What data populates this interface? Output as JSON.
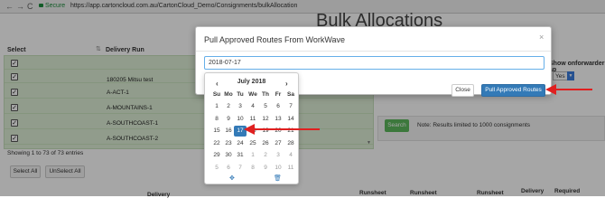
{
  "browser": {
    "back": "←",
    "forward": "→",
    "reload": "C",
    "secure_label": "Secure",
    "url": "https://app.cartoncloud.com.au/CartonCloud_Demo/Consignments/bulkAllocation"
  },
  "page": {
    "title": "Bulk Allocations",
    "select_header": "Select",
    "delivery_run_header": "Delivery Run",
    "rows": [
      {
        "label": ""
      },
      {
        "label": "180205 Mitsu test"
      },
      {
        "label": "A-ACT-1"
      },
      {
        "label": "A-MOUNTAINS-1"
      },
      {
        "label": "A-SOUTHCOAST-1"
      },
      {
        "label": "A-SOUTHCOAST-2"
      }
    ],
    "showing": "Showing 1 to 73 of 73 entries",
    "select_all": "Select All",
    "unselect_all": "UnSelect All",
    "forwarder_label": "Show onforwarder ap",
    "forwarder_value": "Yes",
    "search_button": "Search",
    "note": "Note: Results limited to 1000 consignments",
    "bottom_headers": [
      "Delivery",
      "Runsheet",
      "Runsheet",
      "Runsheet",
      "Delivery",
      "Required"
    ]
  },
  "modal": {
    "title": "Pull Approved Routes From WorkWave",
    "close_x": "×",
    "date_value": "2018-07-17",
    "close_label": "Close",
    "pull_label": "Pull Approved Routes"
  },
  "datepicker": {
    "month_label": "July 2018",
    "prev": "‹",
    "next": "›",
    "dow": [
      "Su",
      "Mo",
      "Tu",
      "We",
      "Th",
      "Fr",
      "Sa"
    ],
    "weeks": [
      [
        "1",
        "2",
        "3",
        "4",
        "5",
        "6",
        "7"
      ],
      [
        "8",
        "9",
        "10",
        "11",
        "12",
        "13",
        "14"
      ],
      [
        "15",
        "16",
        "17",
        "18",
        "19",
        "20",
        "21"
      ],
      [
        "22",
        "23",
        "24",
        "25",
        "26",
        "27",
        "28"
      ],
      [
        "29",
        "30",
        "31",
        "1",
        "2",
        "3",
        "4"
      ],
      [
        "5",
        "6",
        "7",
        "8",
        "9",
        "10",
        "11"
      ]
    ],
    "selected_day": "17",
    "clock_icon": "✥",
    "trash_icon": "🗑"
  },
  "colors": {
    "accent": "#337ab7",
    "arrow": "#e02020",
    "panel_green": "#dff0d8"
  }
}
